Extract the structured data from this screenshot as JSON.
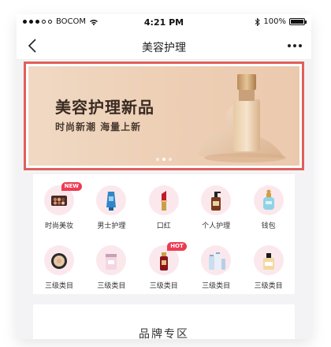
{
  "status_bar": {
    "carrier": "BOCOM",
    "time": "4:21 PM",
    "battery": "100%",
    "battery_level": 1.0
  },
  "nav": {
    "title": "美容护理"
  },
  "banner": {
    "title": "美容护理新品",
    "subtitle": "时尚新潮 海量上新",
    "pages": 3,
    "active_page": 1
  },
  "categories": [
    {
      "label": "时尚美妆",
      "icon": "eyeshadow-palette-icon",
      "badge": "NEW"
    },
    {
      "label": "男士护理",
      "icon": "mens-tube-icon",
      "badge": ""
    },
    {
      "label": "口红",
      "icon": "lipstick-icon",
      "badge": ""
    },
    {
      "label": "个人护理",
      "icon": "pump-bottle-icon",
      "badge": ""
    },
    {
      "label": "钱包",
      "icon": "perfume-bottle-icon",
      "badge": ""
    },
    {
      "label": "三级类目",
      "icon": "compact-powder-icon",
      "badge": ""
    },
    {
      "label": "三级类目",
      "icon": "cream-jar-icon",
      "badge": ""
    },
    {
      "label": "三级类目",
      "icon": "serum-bottle-icon",
      "badge": "HOT"
    },
    {
      "label": "三级类目",
      "icon": "skincare-set-icon",
      "badge": ""
    },
    {
      "label": "三级类目",
      "icon": "perfume-gold-icon",
      "badge": ""
    }
  ],
  "brand_section": {
    "title": "品牌专区"
  },
  "colors": {
    "highlight_border": "#e0605a",
    "badge": "#ee3b52",
    "icon_bg": "#fbe8ec"
  }
}
